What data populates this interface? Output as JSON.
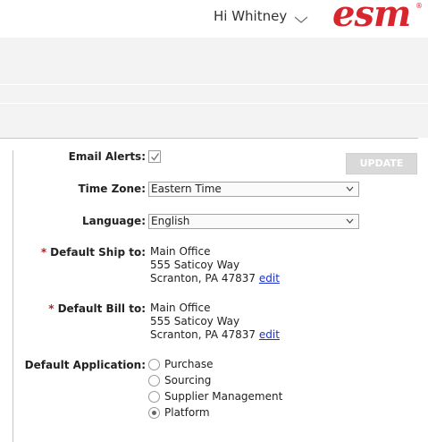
{
  "header": {
    "greeting": "Hi Whitney",
    "logo_text": "esm",
    "logo_mark": "®",
    "brand_color": "#d7262e"
  },
  "form": {
    "email_alerts": {
      "label": "Email Alerts:",
      "checked": true
    },
    "update_button": "UPDATE",
    "time_zone": {
      "label": "Time Zone:",
      "value": "Eastern Time"
    },
    "language": {
      "label": "Language:",
      "value": "English"
    },
    "ship_to": {
      "required_mark": "*",
      "label": "Default Ship to:",
      "line1": "Main Office",
      "line2": "555 Saticoy Way",
      "line3": "Scranton, PA 47837",
      "edit": "edit"
    },
    "bill_to": {
      "required_mark": "*",
      "label": "Default Bill to:",
      "line1": "Main Office",
      "line2": "555 Saticoy Way",
      "line3": "Scranton, PA 47837",
      "edit": "edit"
    },
    "default_application": {
      "label": "Default Application:",
      "options": [
        {
          "label": "Purchase",
          "checked": false
        },
        {
          "label": "Sourcing",
          "checked": false
        },
        {
          "label": "Supplier Management",
          "checked": false
        },
        {
          "label": "Platform",
          "checked": true
        }
      ]
    }
  }
}
